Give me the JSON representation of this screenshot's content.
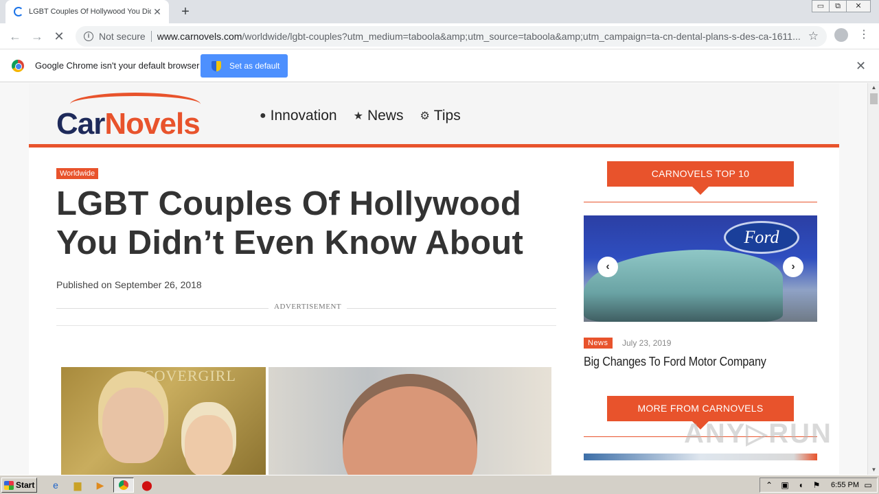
{
  "browser": {
    "tab_title": "LGBT Couples Of Hollywood You Didn’t Even Know About",
    "tab_close": "✕",
    "new_tab": "+",
    "security_label": "Not secure",
    "url_domain": "www.carnovels.com",
    "url_path": "/worldwide/lgbt-couples?utm_medium=taboola&amp;utm_source=taboola&amp;utm_campaign=ta-cn-dental-plans-s-des-ca-1611...",
    "win_min": "▭",
    "win_restore": "⧉",
    "win_close": "✕"
  },
  "infobar": {
    "message": "Google Chrome isn't your default browser",
    "button_label": "Set as default",
    "close": "✕"
  },
  "site": {
    "logo_car": "Car",
    "logo_novels": "Novels",
    "nav": [
      {
        "icon": "globe-icon",
        "glyph": "●",
        "label": "Innovation"
      },
      {
        "icon": "star-icon",
        "glyph": "★",
        "label": "News"
      },
      {
        "icon": "gears-icon",
        "glyph": "⚙",
        "label": "Tips"
      }
    ]
  },
  "article": {
    "category": "Worldwide",
    "headline": "LGBT Couples Of Hollywood You Didn’t Even Know About",
    "published": "Published on September 26, 2018",
    "ad_label": "ADVERTISEMENT",
    "photo_brand": "COVERGIRL"
  },
  "sidebar": {
    "top10_heading": "CARNOVELS TOP 10",
    "featured": {
      "brand": "Ford",
      "category": "News",
      "date": "July 23, 2019",
      "title": "Big Changes To Ford Motor Company",
      "prev": "‹",
      "next": "›"
    },
    "more_heading": "MORE FROM CARNOVELS"
  },
  "watermark": "ANY▷RUN",
  "taskbar": {
    "start_label": "Start",
    "clock": "6:55 PM"
  },
  "colors": {
    "accent": "#e8532c",
    "brand_navy": "#1e2a5a",
    "chrome_blue": "#4d90fe"
  }
}
